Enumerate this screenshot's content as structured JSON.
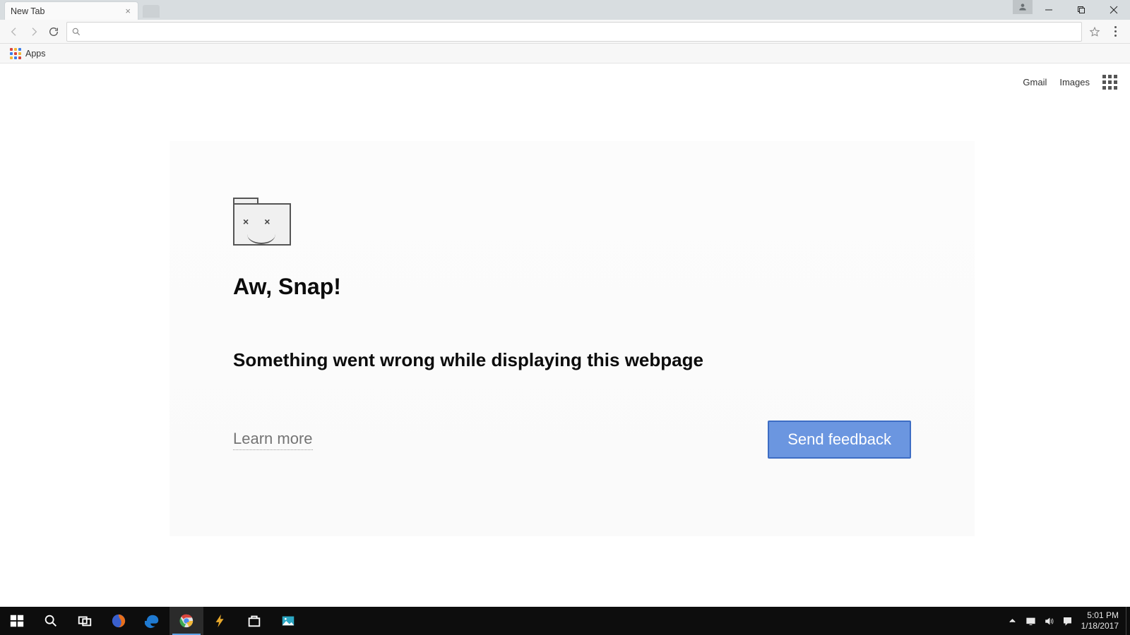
{
  "browser": {
    "tab_title": "New Tab",
    "bookmarks": {
      "apps_label": "Apps"
    },
    "omnibox_value": ""
  },
  "page": {
    "top_links": {
      "gmail": "Gmail",
      "images": "Images"
    },
    "error": {
      "title": "Aw, Snap!",
      "subtitle": "Something went wrong while displaying this webpage",
      "learn_more": "Learn more",
      "send_feedback": "Send feedback"
    }
  },
  "taskbar": {
    "clock_time": "5:01 PM",
    "clock_date": "1/18/2017"
  }
}
